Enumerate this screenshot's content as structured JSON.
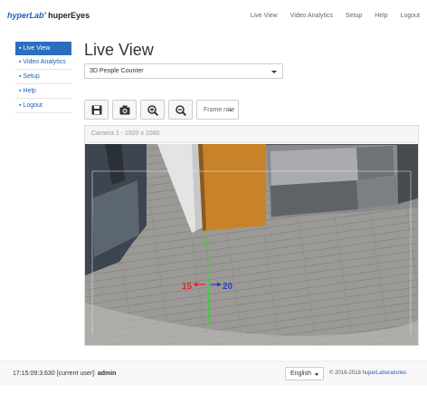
{
  "brand": {
    "part1": "hyperLab'",
    "part2": " huperEyes"
  },
  "nav": [
    "Live View",
    "Video Analytics",
    "Setup",
    "Help",
    "Logout"
  ],
  "sidebar": {
    "items": [
      {
        "label": "▪ Live View"
      },
      {
        "label": "▪ Video Analytics"
      },
      {
        "label": "▪ Setup"
      },
      {
        "label": "▪ Help"
      },
      {
        "label": "▪ Logout"
      }
    ]
  },
  "page_title": "Live View",
  "mode_select": {
    "value": "3D People Counter"
  },
  "toolbar": {
    "frame_rate_label": "Frame rate"
  },
  "camera": {
    "header": "Camera 1 - 1920 x 1080",
    "overlay": {
      "in_count": "15",
      "out_count": "20",
      "line_color": "#3bd13b",
      "in_color": "#e4202a",
      "out_color": "#2a3fbf"
    }
  },
  "footer": {
    "status_time": "17:15:09:3.630",
    "status_label": "[current user]:",
    "status_user": "admin",
    "language": "English",
    "copyright": "© 2016-2018",
    "company": "huperLaboratories"
  },
  "colors": {
    "accent": "#2a6ebd",
    "link": "#1f5fb5"
  }
}
